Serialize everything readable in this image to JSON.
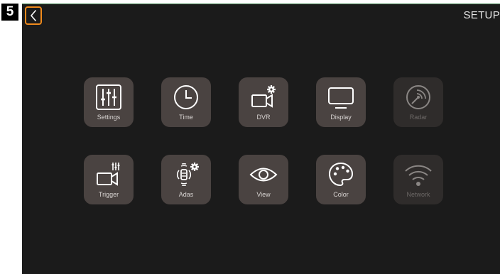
{
  "step_badge": "5",
  "header": {
    "title": "SETUP",
    "back_icon": "chevron-left-icon"
  },
  "colors": {
    "accent": "#f08a1c",
    "tile": "#4a4341",
    "tile_disabled": "#2f2c2b",
    "screen_bg": "#1b1b1b"
  },
  "tiles": [
    {
      "label": "Settings",
      "icon": "sliders-icon",
      "enabled": true
    },
    {
      "label": "Time",
      "icon": "clock-icon",
      "enabled": true
    },
    {
      "label": "DVR",
      "icon": "camera-gear-icon",
      "enabled": true
    },
    {
      "label": "Display",
      "icon": "monitor-icon",
      "enabled": true
    },
    {
      "label": "Radar",
      "icon": "radar-icon",
      "enabled": false
    },
    {
      "label": "Trigger",
      "icon": "camera-sliders-icon",
      "enabled": true
    },
    {
      "label": "Adas",
      "icon": "adas-gear-icon",
      "enabled": true
    },
    {
      "label": "View",
      "icon": "eye-icon",
      "enabled": true
    },
    {
      "label": "Color",
      "icon": "palette-icon",
      "enabled": true
    },
    {
      "label": "Network",
      "icon": "wifi-icon",
      "enabled": false
    }
  ]
}
